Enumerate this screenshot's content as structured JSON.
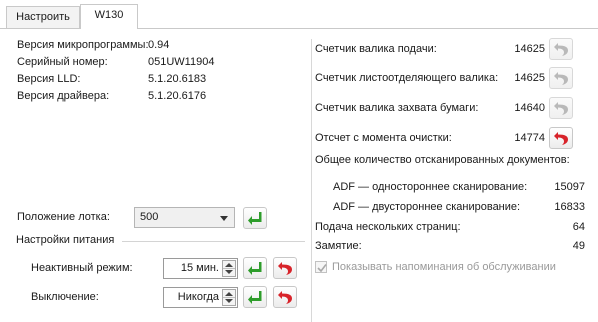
{
  "tabs": [
    {
      "label": "Настроить"
    },
    {
      "label": "W130"
    }
  ],
  "info": {
    "firmware_label": "Версия микропрограммы:",
    "firmware_value": "0.94",
    "serial_label": "Серийный номер:",
    "serial_value": "051UW11904",
    "lld_label": "Версия LLD:",
    "lld_value": "5.1.20.6183",
    "driver_label": "Версия драйвера:",
    "driver_value": "5.1.20.6176"
  },
  "tray": {
    "label": "Положение лотка:",
    "value": "500"
  },
  "power": {
    "group_label": "Настройки питания",
    "inactive_label": "Неактивный режим:",
    "inactive_value": "15 мин.",
    "off_label": "Выключение:",
    "off_value": "Никогда"
  },
  "counters": {
    "feed_roller_label": "Счетчик валика подачи:",
    "feed_roller_value": "14625",
    "separation_roller_label": "Счетчик листоотделяющего валика:",
    "separation_roller_value": "14625",
    "pickup_roller_label": "Счетчик валика захвата бумаги:",
    "pickup_roller_value": "14640",
    "since_cleaning_label": "Отсчет с момента очистки:",
    "since_cleaning_value": "14774",
    "total_scanned_label": "Общее количество отсканированных документов:",
    "adf_simplex_label": "ADF — одностороннее сканирование:",
    "adf_simplex_value": "15097",
    "adf_duplex_label": "ADF — двустороннее сканирование:",
    "adf_duplex_value": "16833",
    "multifeed_label": "Подача нескольких страниц:",
    "multifeed_value": "64",
    "jam_label": "Замятие:",
    "jam_value": "49"
  },
  "maintenance": {
    "reminder_label": "Показывать напоминания об обслуживании",
    "reminder_checked": true
  },
  "colors": {
    "apply_green": "#2e9d2b",
    "reset_red": "#d8232a",
    "reset_disabled": "#b9b9b9"
  }
}
